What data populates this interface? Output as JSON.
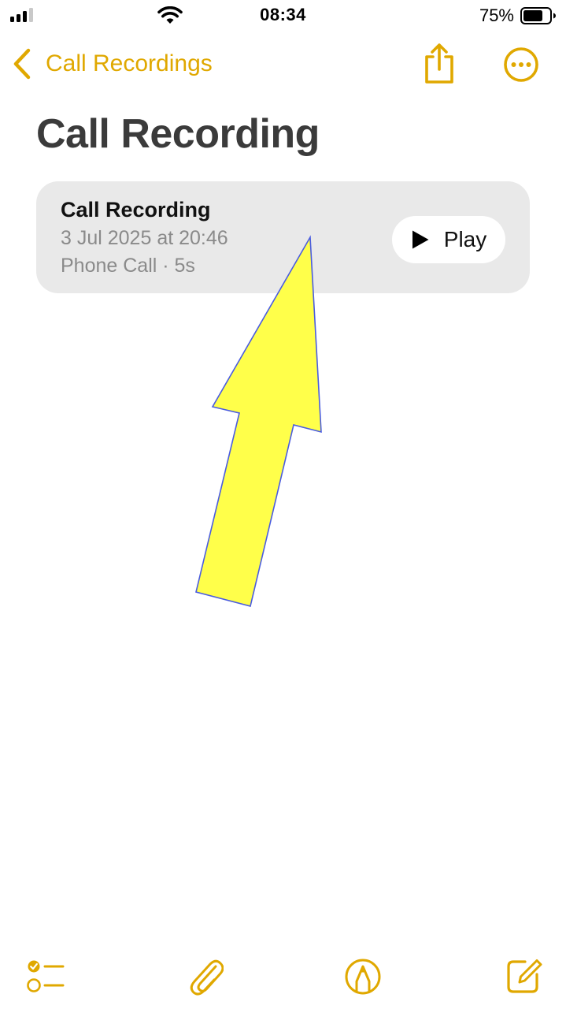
{
  "status_bar": {
    "time": "08:34",
    "battery_percent": "75%",
    "battery_level": 0.75
  },
  "nav": {
    "back_label": "Call Recordings"
  },
  "page": {
    "title": "Call Recording"
  },
  "recording": {
    "title": "Call Recording",
    "date": "3 Jul 2025 at 20:46",
    "meta": "Phone Call · 5s",
    "play_label": "Play"
  },
  "colors": {
    "accent": "#e0a800",
    "card_bg": "#e9e9e9",
    "arrow_fill": "#ffff4a",
    "arrow_stroke": "#4a5ce0"
  },
  "icons": {
    "back": "chevron-left-icon",
    "share": "share-icon",
    "more": "ellipsis-circle-icon",
    "play": "play-icon",
    "checklist": "checklist-icon",
    "attach": "paperclip-icon",
    "markup": "markup-pen-icon",
    "compose": "compose-icon"
  }
}
